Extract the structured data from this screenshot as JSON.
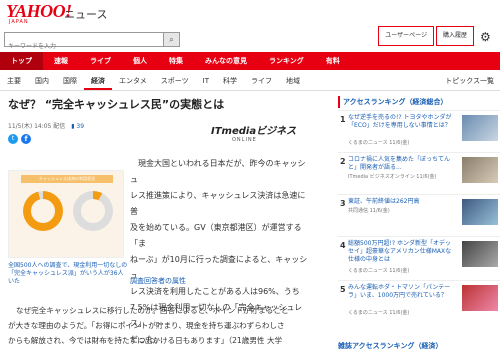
{
  "header": {
    "logo": "YAHOO!",
    "logo_sub": "JAPAN",
    "section_title": "ニュース",
    "links": [
      "ユーザーページ",
      "購入履歴"
    ],
    "settings_icon": "gear-icon"
  },
  "search": {
    "placeholder": "キーワードを入力",
    "icon": "search-icon"
  },
  "nav": {
    "items": [
      "トップ",
      "速報",
      "ライブ",
      "個人",
      "特集",
      "みんなの意見",
      "ランキング",
      "有料"
    ],
    "active_index": 0
  },
  "subnav": {
    "items": [
      "主要",
      "国内",
      "国際",
      "経済",
      "エンタメ",
      "スポーツ",
      "IT",
      "科学",
      "ライフ",
      "地域"
    ],
    "active_index": 3,
    "topics_label": "トピックス一覧"
  },
  "article": {
    "headline": "なぜ？ “完全キャッシュレス民”の実態とは",
    "date": "11/5(木) 14:05 配信",
    "comment_count": "39",
    "source_logo": "ITmediaビジネス",
    "source_logo_sub": "ONLINE",
    "figure_title": "キャッシュレス決済の利用状況",
    "figure_caption": "全国500人への調査で、現金利用一切なしの「完全キャッシュレス派」がいう人が36人いた",
    "body_lines": [
      "現金大国といわれる日本だが、昨今のキャッシュ",
      "レス推進策により、キャッシュレス決済は急速に普",
      "及を始めている。GV（東京都港区）が運営する「ま",
      "ねーぶ」が10月に行った調査によると、キャッシュ",
      "レス決済を利用したことがある人は96%、うち",
      "7.5%は現金利用一切なしの「完全キャッシュレス」",
      "だった。"
    ],
    "attr_link": "調査回答者の属性",
    "bottom_lines": [
      "なぜ完全キャッシュレスに移行したのか。回答によると、ポイントが貯まること",
      "が大きな理由のようだ。「お得にポイントが貯まり、現金を持ち運ぶわずらわしさ",
      "からも解放され、今では財布を持たずに出かける日もあります」（21歳男性 大学"
    ]
  },
  "ranking": {
    "title": "アクセスランキング（経済総合）",
    "items": [
      {
        "rank": "1",
        "title": "なぜ逆手を売るの!? トヨタやホンダが「ECO」だけを専用しない事情とは？",
        "source": "くるまのニュース 11/6(金)"
      },
      {
        "rank": "2",
        "title": "コロナ禍に人気を集めた「ぼっちてんと」開発者が語る...",
        "source": "ITmedia ビジネスオンライン 11/6(金)"
      },
      {
        "rank": "3",
        "title": "東証、午前終値は262円高",
        "source": "共同通信 11/6(金)"
      },
      {
        "rank": "4",
        "title": "総額500万円超!? ホンダ新型「オデッセイ」超豪華なアメリカン仕様MAXな仕様の中身とは",
        "source": "くるまのニュース 11/6(金)"
      },
      {
        "rank": "5",
        "title": "みんな運転ホダ・トマソン「パンテーラ」いま、1000万円で売れている？",
        "source": "くるまのニュース 11/6(金)"
      }
    ],
    "bottom_title": "雑誌アクセスランキング（経済）"
  },
  "chart_colors": {
    "brand_red": "#e60012",
    "link_blue": "#1a5fb4",
    "donut_orange": "#f39c12"
  }
}
